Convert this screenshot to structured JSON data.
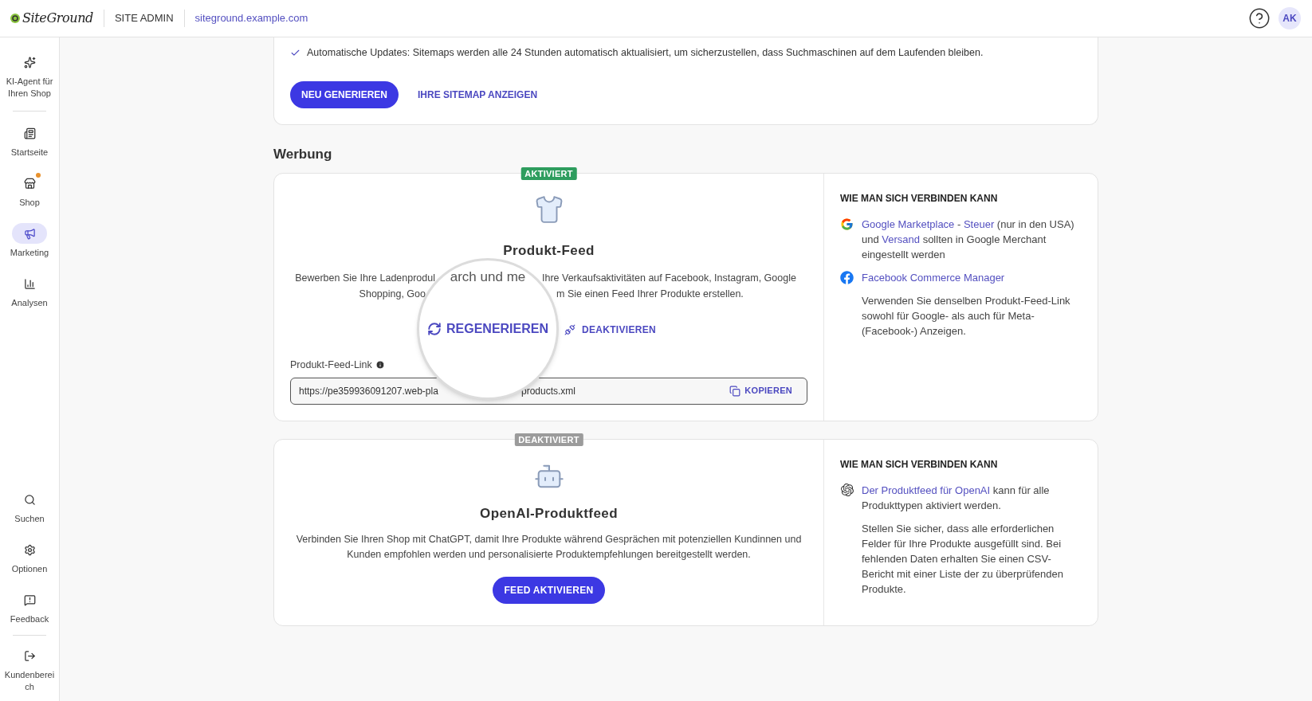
{
  "header": {
    "logo": "SiteGround",
    "section": "SITE ADMIN",
    "domain": "siteground.example.com",
    "avatar": "AK"
  },
  "sidebar": {
    "top": [
      {
        "label": "KI-Agent für Ihren Shop",
        "selected": false,
        "notification": false
      }
    ],
    "main": [
      {
        "label": "Startseite",
        "selected": false,
        "notification": false
      },
      {
        "label": "Shop",
        "selected": false,
        "notification": true
      },
      {
        "label": "Marketing",
        "selected": true,
        "notification": false
      },
      {
        "label": "Analysen",
        "selected": false,
        "notification": false
      }
    ],
    "tools": [
      {
        "label": "Suchen",
        "selected": false,
        "notification": false
      },
      {
        "label": "Optionen",
        "selected": false,
        "notification": false
      },
      {
        "label": "Feedback",
        "selected": false,
        "notification": false
      }
    ],
    "account": [
      {
        "label": "Kundenbereich",
        "selected": false,
        "notification": false
      }
    ]
  },
  "sitemap": {
    "note": "Automatische Updates: Sitemaps werden alle 24 Stunden automatisch aktualisiert, um sicherzustellen, dass Suchmaschinen auf dem Laufenden bleiben.",
    "buttons": [
      {
        "label": "NEU GENERIEREN",
        "kind": "primary"
      },
      {
        "label": "IHRE SITEMAP ANZEIGEN",
        "kind": "text"
      }
    ]
  },
  "section_title": "Werbung",
  "feeds": [
    {
      "kind": "product",
      "status": {
        "label": "AKTIVIERT",
        "active": true
      },
      "title": "Produkt-Feed",
      "description_lines": [
        {
          "left": "Bewerben Sie Ihre Ladenprodul",
          "right": "Ihre Verkaufsaktivitäten auf Facebook, Instagram, Google"
        },
        {
          "left": "Shopping, Goo",
          "right": "m Sie einen Feed Ihrer Produkte erstellen."
        }
      ],
      "secondary_action": "DEAKTIVIEREN",
      "link_label": "Produkt-Feed-Link",
      "link_value_left": "https://pe359936091207.web-pla",
      "link_value_right": "products.xml",
      "copy_label": "KOPIEREN",
      "magnifier": {
        "text": "arch und me",
        "button": "REGENERIEREN"
      },
      "help": {
        "title": "WIE MAN SICH VERBINDEN KANN",
        "items": [
          {
            "paragraphs": [
              [
                {
                  "text": "Google Marketplace",
                  "link": true
                },
                {
                  "text": " - ",
                  "link": false
                },
                {
                  "text": "Steuer",
                  "link": true
                },
                {
                  "text": " (nur in den USA) und ",
                  "link": false
                },
                {
                  "text": "Versand",
                  "link": true
                },
                {
                  "text": " sollten in Google Merchant eingestellt werden",
                  "link": false
                }
              ]
            ]
          },
          {
            "paragraphs": [
              [
                {
                  "text": "Facebook Commerce Manager",
                  "link": true
                }
              ],
              [
                {
                  "text": "Verwenden Sie denselben Produkt-Feed-Link sowohl für Google- als auch für Meta-(Facebook-) Anzeigen.",
                  "link": false
                }
              ]
            ]
          }
        ]
      }
    },
    {
      "kind": "openai",
      "status": {
        "label": "DEAKTIVIERT",
        "active": false
      },
      "title": "OpenAI-Produktfeed",
      "description": "Verbinden Sie Ihren Shop mit ChatGPT, damit Ihre Produkte während Gesprächen mit potenziellen Kundinnen und Kunden empfohlen werden und personalisierte Produktempfehlungen bereitgestellt werden.",
      "button": "FEED AKTIVIEREN",
      "help": {
        "title": "WIE MAN SICH VERBINDEN KANN",
        "items": [
          {
            "paragraphs": [
              [
                {
                  "text": "Der Produktfeed für OpenAI",
                  "link": true
                },
                {
                  "text": " kann für alle Produkttypen aktiviert werden.",
                  "link": false
                }
              ],
              [
                {
                  "text": "Stellen Sie sicher, dass alle erforderlichen Felder für Ihre Produkte ausgefüllt sind. Bei fehlenden Daten erhalten Sie einen CSV-Bericht mit einer Liste der zu überprüfenden Produkte.",
                  "link": false
                }
              ]
            ]
          }
        ]
      }
    }
  ]
}
